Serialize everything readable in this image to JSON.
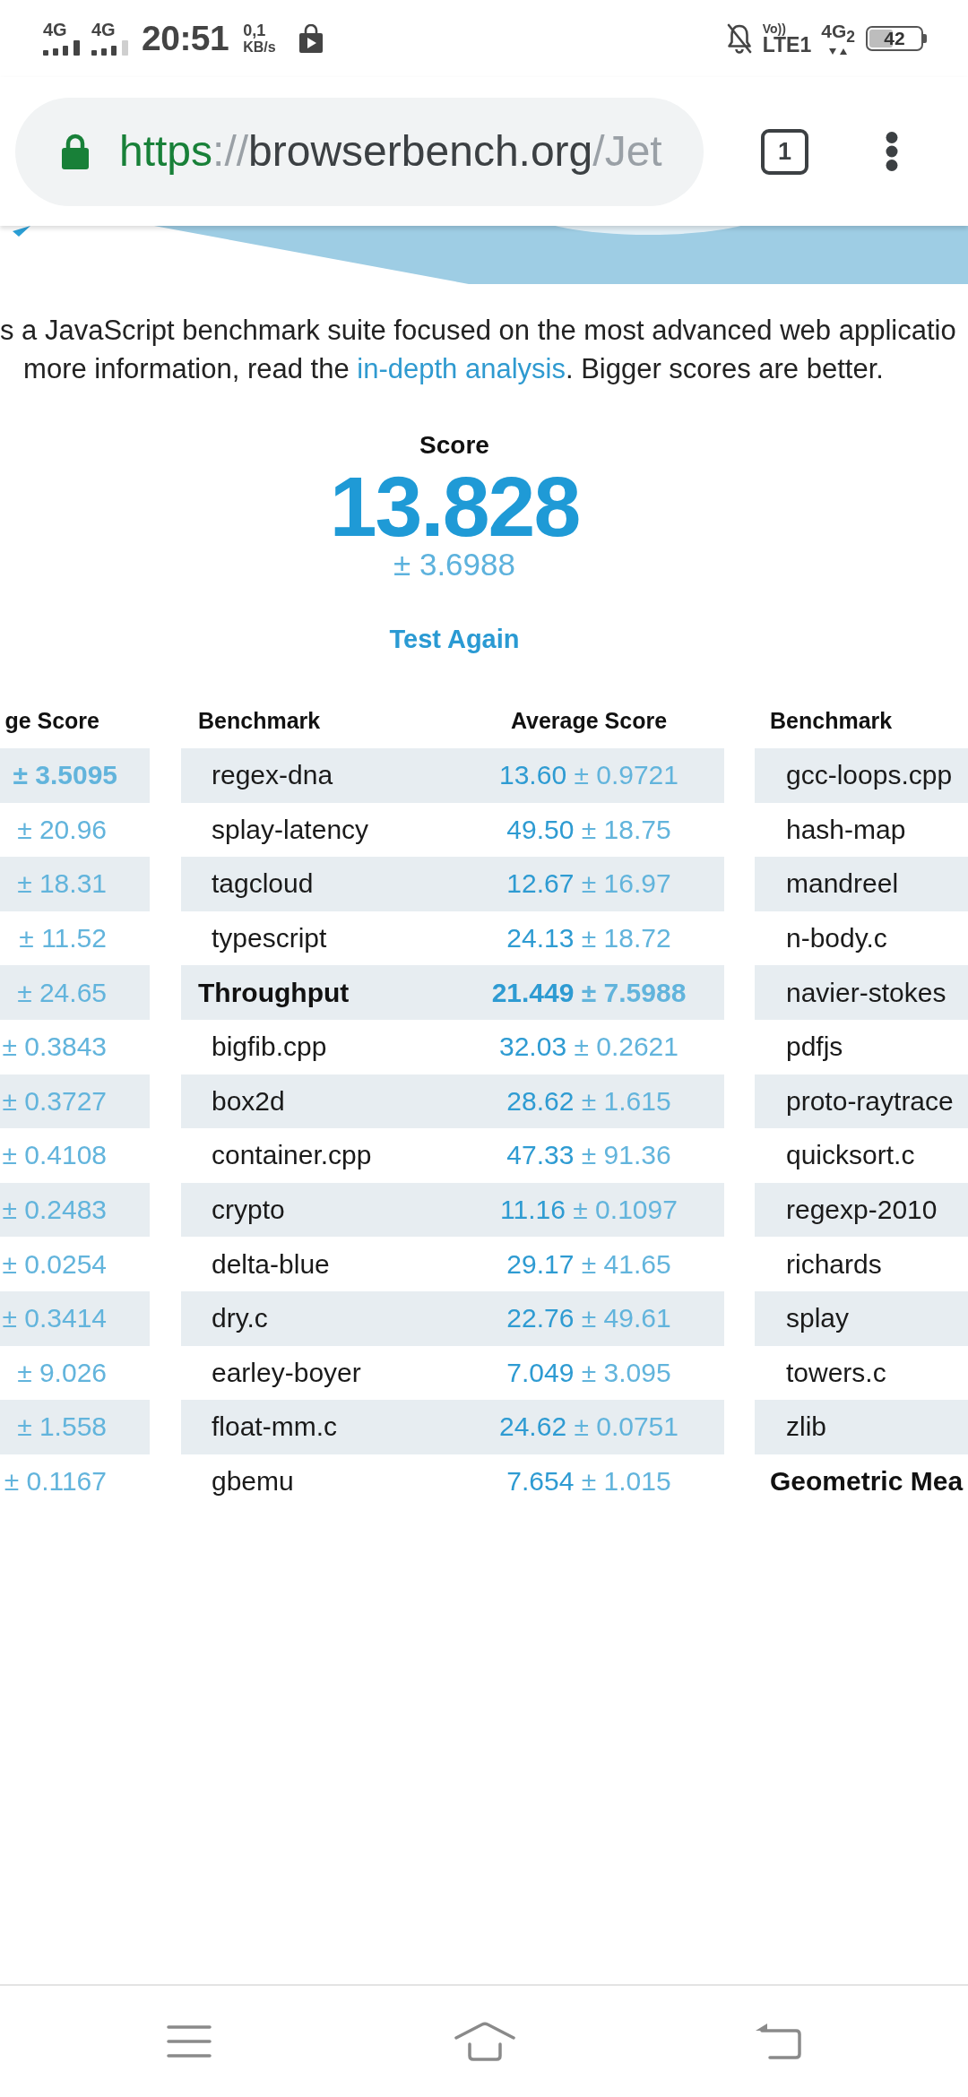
{
  "status_bar": {
    "sims": [
      {
        "label": "4G",
        "kind": "full"
      },
      {
        "label": "4G",
        "kind": "partial"
      }
    ],
    "time": "20:51",
    "speed": {
      "value": "0,1",
      "unit": "KB/s"
    },
    "volte": {
      "top": "Vo))",
      "bottom": "LTE1"
    },
    "network": "4G$_{2}$",
    "battery": "42"
  },
  "browser": {
    "url": {
      "scheme": "https",
      "separator": "://",
      "host": "browserbench.org",
      "path": "/Jet"
    },
    "tab_count": "1"
  },
  "intro": {
    "line_1": "s a JavaScript benchmark suite focused on the most advanced web applicatio",
    "line_2_lead": "more information, read the ",
    "link": "in-depth analysis",
    "line_2_tail": ". Bigger scores are better."
  },
  "score": {
    "label": "Score",
    "value": "13.828",
    "error": "± 3.6988",
    "action": "Test Again"
  },
  "tables": [
    {
      "columns": [
        {
          "label": "ge Score",
          "kind": "score"
        }
      ],
      "rows": [
        {
          "error": "± 3.5095",
          "summary": true
        },
        {
          "error": "± 20.96",
          "summary": false
        },
        {
          "error": "± 18.31",
          "summary": false
        },
        {
          "error": "± 11.52",
          "summary": false
        },
        {
          "error": "± 24.65",
          "summary": false
        },
        {
          "error": "± 0.3843",
          "summary": false
        },
        {
          "error": "± 0.3727",
          "summary": false
        },
        {
          "error": "± 0.4108",
          "summary": false
        },
        {
          "error": "± 0.2483",
          "summary": false
        },
        {
          "error": "± 0.0254",
          "summary": false
        },
        {
          "error": "± 0.3414",
          "summary": false
        },
        {
          "error": "± 9.026",
          "summary": false
        },
        {
          "error": "± 1.558",
          "summary": false
        },
        {
          "error": "± 0.1167",
          "summary": false
        }
      ]
    },
    {
      "columns": [
        {
          "label": "Benchmark",
          "kind": "name"
        },
        {
          "label": "Average Score",
          "kind": "score"
        }
      ],
      "rows": [
        {
          "name": "regex-dna",
          "mean": "13.60",
          "error": "± 0.9721",
          "summary": false
        },
        {
          "name": "splay-latency",
          "mean": "49.50",
          "error": "± 18.75",
          "summary": false
        },
        {
          "name": "tagcloud",
          "mean": "12.67",
          "error": "± 16.97",
          "summary": false
        },
        {
          "name": "typescript",
          "mean": "24.13",
          "error": "± 18.72",
          "summary": false
        },
        {
          "name": "Throughput",
          "mean": "21.449",
          "error": "± 7.5988",
          "summary": true
        },
        {
          "name": "bigfib.cpp",
          "mean": "32.03",
          "error": "± 0.2621",
          "summary": false
        },
        {
          "name": "box2d",
          "mean": "28.62",
          "error": "± 1.615",
          "summary": false
        },
        {
          "name": "container.cpp",
          "mean": "47.33",
          "error": "± 91.36",
          "summary": false
        },
        {
          "name": "crypto",
          "mean": "11.16",
          "error": "± 0.1097",
          "summary": false
        },
        {
          "name": "delta-blue",
          "mean": "29.17",
          "error": "± 41.65",
          "summary": false
        },
        {
          "name": "dry.c",
          "mean": "22.76",
          "error": "± 49.61",
          "summary": false
        },
        {
          "name": "earley-boyer",
          "mean": "7.049",
          "error": "± 3.095",
          "summary": false
        },
        {
          "name": "float-mm.c",
          "mean": "24.62",
          "error": "± 0.0751",
          "summary": false
        },
        {
          "name": "gbemu",
          "mean": "7.654",
          "error": "± 1.015",
          "summary": false
        }
      ]
    },
    {
      "columns": [
        {
          "label": "Benchmark",
          "kind": "name"
        }
      ],
      "rows": [
        {
          "name": "gcc-loops.cpp",
          "summary": false
        },
        {
          "name": "hash-map",
          "summary": false
        },
        {
          "name": "mandreel",
          "summary": false
        },
        {
          "name": "n-body.c",
          "summary": false
        },
        {
          "name": "navier-stokes",
          "summary": false
        },
        {
          "name": "pdfjs",
          "summary": false
        },
        {
          "name": "proto-raytrace",
          "summary": false
        },
        {
          "name": "quicksort.c",
          "summary": false
        },
        {
          "name": "regexp-2010",
          "summary": false
        },
        {
          "name": "richards",
          "summary": false
        },
        {
          "name": "splay",
          "summary": false
        },
        {
          "name": "towers.c",
          "summary": false
        },
        {
          "name": "zlib",
          "summary": false
        },
        {
          "name": "Geometric Mea",
          "summary": true
        }
      ]
    }
  ]
}
